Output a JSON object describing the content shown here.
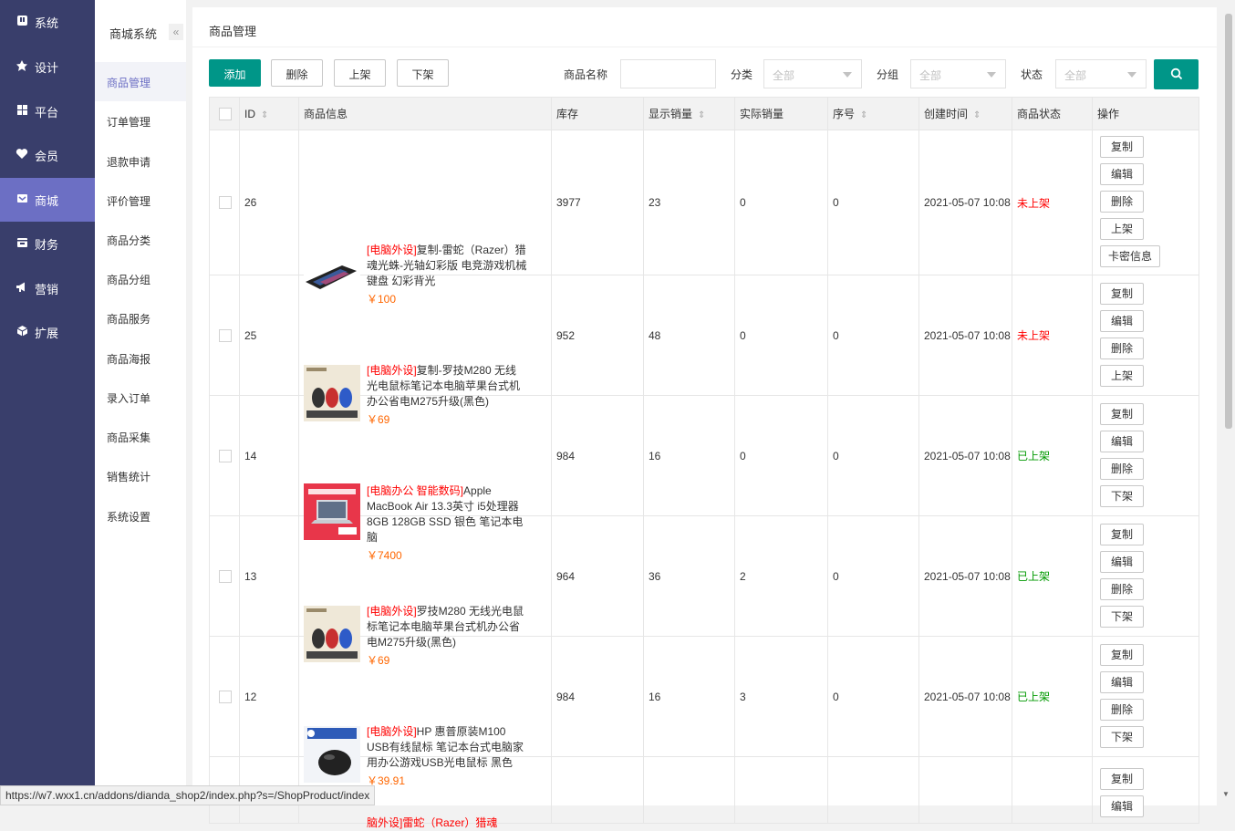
{
  "nav1": [
    {
      "label": "系统",
      "icon": "system-icon"
    },
    {
      "label": "设计",
      "icon": "design-icon"
    },
    {
      "label": "平台",
      "icon": "platform-icon"
    },
    {
      "label": "会员",
      "icon": "member-icon"
    },
    {
      "label": "商城",
      "icon": "mall-icon",
      "active": true
    },
    {
      "label": "财务",
      "icon": "finance-icon"
    },
    {
      "label": "营销",
      "icon": "marketing-icon"
    },
    {
      "label": "扩展",
      "icon": "extension-icon"
    }
  ],
  "nav2": {
    "title": "商城系统",
    "collapse": "«",
    "items": [
      "商品管理",
      "订单管理",
      "退款申请",
      "评价管理",
      "商品分类",
      "商品分组",
      "商品服务",
      "商品海报",
      "录入订单",
      "商品采集",
      "销售统计",
      "系统设置"
    ]
  },
  "breadcrumb": "商品管理",
  "toolbar": {
    "add": "添加",
    "delete": "删除",
    "on_shelf": "上架",
    "off_shelf": "下架"
  },
  "filters": {
    "name_label": "商品名称",
    "name_value": "",
    "category_label": "分类",
    "category_value": "全部",
    "group_label": "分组",
    "group_value": "全部",
    "status_label": "状态",
    "status_value": "全部"
  },
  "table": {
    "headers": {
      "id": "ID",
      "info": "商品信息",
      "stock": "库存",
      "shown_sales": "显示销量",
      "actual_sales": "实际销量",
      "order": "序号",
      "created": "创建时间",
      "status": "商品状态",
      "ops": "操作"
    },
    "rows": [
      {
        "id": "26",
        "cat": "[电脑外设]",
        "name": "复制-雷蛇（Razer）猎魂光蛛-光轴幻彩版 电竞游戏机械键盘 幻彩背光",
        "price": "￥100",
        "stock": "3977",
        "shown": "23",
        "actual": "0",
        "order": "0",
        "created": "2021-05-07 10:08",
        "status": "未上架",
        "ops": [
          "复制",
          "编辑",
          "删除",
          "上架",
          "卡密信息"
        ]
      },
      {
        "id": "25",
        "cat": "[电脑外设]",
        "name": "复制-罗技M280 无线光电鼠标笔记本电脑苹果台式机办公省电M275升级(黑色)",
        "price": "￥69",
        "stock": "952",
        "shown": "48",
        "actual": "0",
        "order": "0",
        "created": "2021-05-07 10:08",
        "status": "未上架",
        "ops": [
          "复制",
          "编辑",
          "删除",
          "上架"
        ]
      },
      {
        "id": "14",
        "cat": "[电脑办公 智能数码]",
        "name": "Apple MacBook Air 13.3英寸 i5处理器 8GB 128GB SSD 银色 笔记本电脑",
        "price": "￥7400",
        "stock": "984",
        "shown": "16",
        "actual": "0",
        "order": "0",
        "created": "2021-05-07 10:08",
        "status": "已上架",
        "ops": [
          "复制",
          "编辑",
          "删除",
          "下架"
        ]
      },
      {
        "id": "13",
        "cat": "[电脑外设]",
        "name": "罗技M280 无线光电鼠标笔记本电脑苹果台式机办公省电M275升级(黑色)",
        "price": "￥69",
        "stock": "964",
        "shown": "36",
        "actual": "2",
        "order": "0",
        "created": "2021-05-07 10:08",
        "status": "已上架",
        "ops": [
          "复制",
          "编辑",
          "删除",
          "下架"
        ]
      },
      {
        "id": "12",
        "cat": "[电脑外设]",
        "name": "HP 惠普原装M100 USB有线鼠标 笔记本台式电脑家用办公游戏USB光电鼠标 黑色",
        "price": "￥39.91",
        "stock": "984",
        "shown": "16",
        "actual": "3",
        "order": "0",
        "created": "2021-05-07 10:08",
        "status": "已上架",
        "ops": [
          "复制",
          "编辑",
          "删除",
          "下架"
        ]
      }
    ],
    "partial_row": {
      "text": "脑外设]雷蛇（Razer）猎魂",
      "ops": [
        "复制",
        "编辑"
      ]
    }
  },
  "status_url": "https://w7.wxx1.cn/addons/dianda_shop2/index.php?s=/ShopProduct/index",
  "colors": {
    "sidebar": "#393e6b",
    "sidebar_active": "#6c6fc4",
    "primary": "#009688",
    "off": "#ff0000",
    "on": "#009900",
    "price": "#ff6600"
  }
}
